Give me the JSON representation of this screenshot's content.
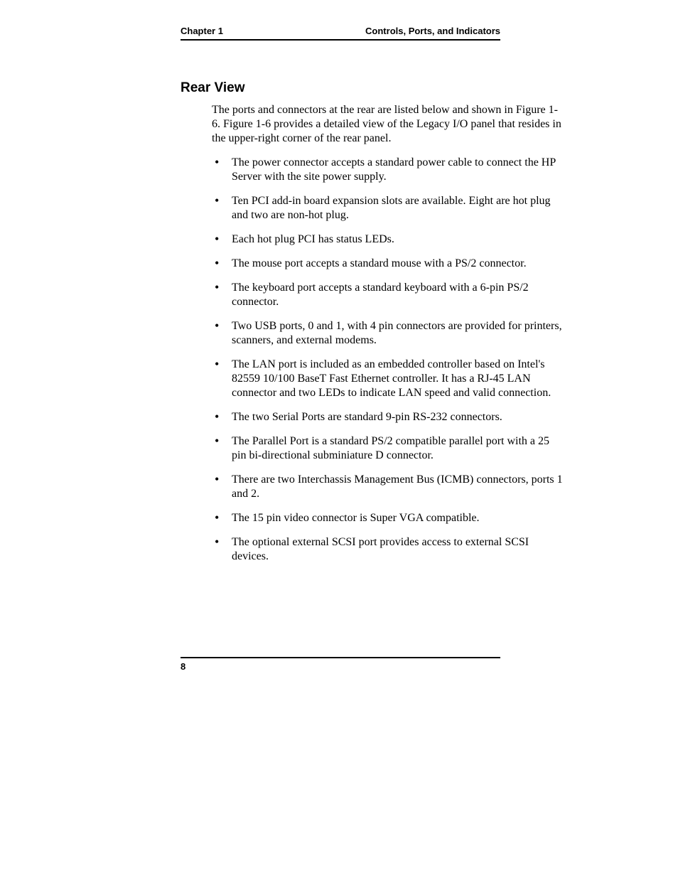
{
  "header": {
    "left": "Chapter 1",
    "right": "Controls, Ports, and Indicators"
  },
  "section": {
    "heading": "Rear View",
    "intro": "The ports and connectors at the rear are listed below and shown in Figure 1-6. Figure 1-6 provides a detailed view of the Legacy I/O panel that resides in the upper-right corner of the rear panel.",
    "bullets": [
      "The power connector accepts a standard power cable to connect the HP Server with the site power supply.",
      "Ten PCI add-in board expansion slots are available.  Eight are hot plug and two are non-hot plug.",
      "Each hot plug PCI has status LEDs.",
      "The mouse port accepts a standard mouse with a PS/2 connector.",
      "The keyboard port accepts a standard keyboard with a 6-pin PS/2 connector.",
      "Two USB ports, 0 and 1, with 4 pin connectors are provided for printers, scanners, and external modems.",
      "The LAN port is included as an embedded controller based on Intel's 82559 10/100 BaseT Fast Ethernet controller. It has a RJ-45 LAN connector and two LEDs to indicate LAN speed and valid connection.",
      "The two Serial Ports are standard 9-pin RS-232 connectors.",
      "The Parallel Port is a standard PS/2 compatible parallel port with a 25 pin bi-directional subminiature D connector.",
      "There are two Interchassis Management Bus (ICMB) connectors, ports 1 and 2.",
      "The 15 pin video connector is Super VGA compatible.",
      "The optional external SCSI port provides access to external SCSI devices."
    ]
  },
  "footer": {
    "page_number": "8"
  }
}
